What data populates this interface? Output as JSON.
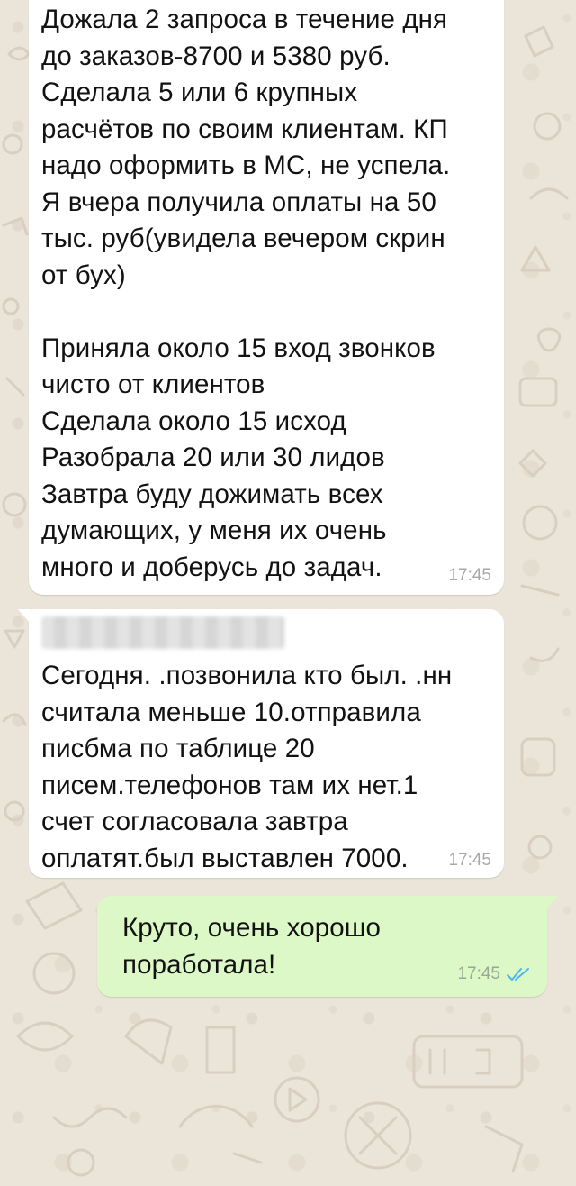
{
  "messages": [
    {
      "direction": "incoming",
      "text": "Дожала 2 запроса в течение дня\nдо заказов-8700 и 5380 руб.\nСделала 5 или 6 крупных\nрасчётов по своим клиентам. КП\nнадо оформить в МС, не успела.\nЯ вчера получила оплаты на 50\nтыс. руб(увидела вечером скрин\nот бух)\n\nПриняла около 15 вход звонков\nчисто от клиентов\nСделала около 15 исход\nРазобрала 20 или 30 лидов\nЗавтра буду дожимать всех\nдумающих, у меня их очень\nмного и доберусь до задач.",
      "time": "17:45"
    },
    {
      "direction": "incoming",
      "sender": "",
      "text": "Сегодня. .позвонила кто был. .нн\nсчитала меньше 10.отправила\nписбма по таблице 20\nписем.телефонов там их нет.1\nсчет согласовала завтра\nоплатят.был выставлен 7000.",
      "time": "17:45"
    },
    {
      "direction": "outgoing",
      "text": "Круто, очень хорошо\nпоработала!",
      "time": "17:45",
      "status_icon": "double-check-read-icon"
    }
  ],
  "colors": {
    "wallpaper": "#ebe4d9",
    "incoming_bubble": "#ffffff",
    "outgoing_bubble": "#dcf8c6",
    "read_ticks": "#4fb6ec",
    "timestamp": "#a8a8a8"
  }
}
